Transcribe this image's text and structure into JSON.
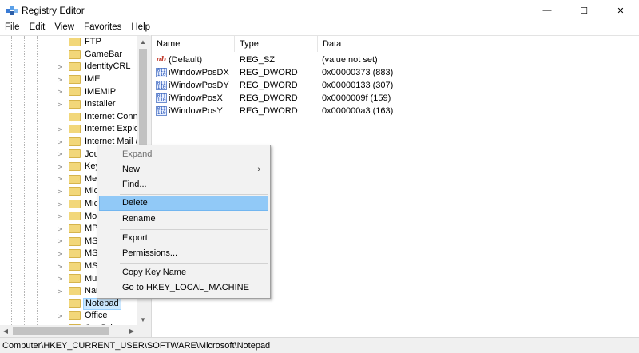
{
  "window": {
    "title": "Registry Editor",
    "minimize_glyph": "—",
    "maximize_glyph": "☐",
    "close_glyph": "✕"
  },
  "menu": [
    "File",
    "Edit",
    "View",
    "Favorites",
    "Help"
  ],
  "tree": {
    "items": [
      {
        "label": "FTP",
        "arrow": ""
      },
      {
        "label": "GameBar",
        "arrow": ""
      },
      {
        "label": "IdentityCRL",
        "arrow": ">"
      },
      {
        "label": "IME",
        "arrow": ">"
      },
      {
        "label": "IMEMIP",
        "arrow": ">"
      },
      {
        "label": "Installer",
        "arrow": ">"
      },
      {
        "label": "Internet Conne",
        "arrow": ""
      },
      {
        "label": "Internet Explor",
        "arrow": ">"
      },
      {
        "label": "Internet Mail a",
        "arrow": ">"
      },
      {
        "label": "Jour",
        "arrow": ">"
      },
      {
        "label": "Key",
        "arrow": ">"
      },
      {
        "label": "Med",
        "arrow": ">"
      },
      {
        "label": "Mic",
        "arrow": ">"
      },
      {
        "label": "Mic",
        "arrow": ">"
      },
      {
        "label": "Mol",
        "arrow": ">"
      },
      {
        "label": "MPI",
        "arrow": ">"
      },
      {
        "label": "MS",
        "arrow": ">"
      },
      {
        "label": "MSD",
        "arrow": ">"
      },
      {
        "label": "MSF",
        "arrow": ">"
      },
      {
        "label": "Mul",
        "arrow": ">"
      },
      {
        "label": "Nar",
        "arrow": ">"
      },
      {
        "label": "Notepad",
        "arrow": ""
      },
      {
        "label": "Office",
        "arrow": ">"
      },
      {
        "label": "OneDrive",
        "arrow": ">"
      }
    ],
    "selected": "Notepad",
    "scroll_up": "▲",
    "scroll_down": "▼",
    "scroll_left": "◀",
    "scroll_right": "▶"
  },
  "values": {
    "columns": {
      "name": "Name",
      "type": "Type",
      "data": "Data"
    },
    "rows": [
      {
        "icon": "string-value-icon",
        "icon_text": "ab",
        "name": "(Default)",
        "type": "REG_SZ",
        "data": "(value not set)"
      },
      {
        "icon": "dword-value-icon",
        "icon_text": "011 110",
        "name": "iWindowPosDX",
        "type": "REG_DWORD",
        "data": "0x00000373 (883)"
      },
      {
        "icon": "dword-value-icon",
        "icon_text": "011 110",
        "name": "iWindowPosDY",
        "type": "REG_DWORD",
        "data": "0x00000133 (307)"
      },
      {
        "icon": "dword-value-icon",
        "icon_text": "011 110",
        "name": "iWindowPosX",
        "type": "REG_DWORD",
        "data": "0x0000009f (159)"
      },
      {
        "icon": "dword-value-icon",
        "icon_text": "011 110",
        "name": "iWindowPosY",
        "type": "REG_DWORD",
        "data": "0x000000a3 (163)"
      }
    ]
  },
  "context_menu": {
    "expand": "Expand",
    "new": "New",
    "new_arrow": "›",
    "find": "Find...",
    "delete": "Delete",
    "rename": "Rename",
    "export": "Export",
    "permissions": "Permissions...",
    "copy_key_name": "Copy Key Name",
    "goto": "Go to HKEY_LOCAL_MACHINE"
  },
  "status": {
    "path": "Computer\\HKEY_CURRENT_USER\\SOFTWARE\\Microsoft\\Notepad"
  },
  "colors": {
    "selection": "#cce8ff",
    "menu_highlight": "#91c9f7",
    "folder": "#f2d77a"
  }
}
